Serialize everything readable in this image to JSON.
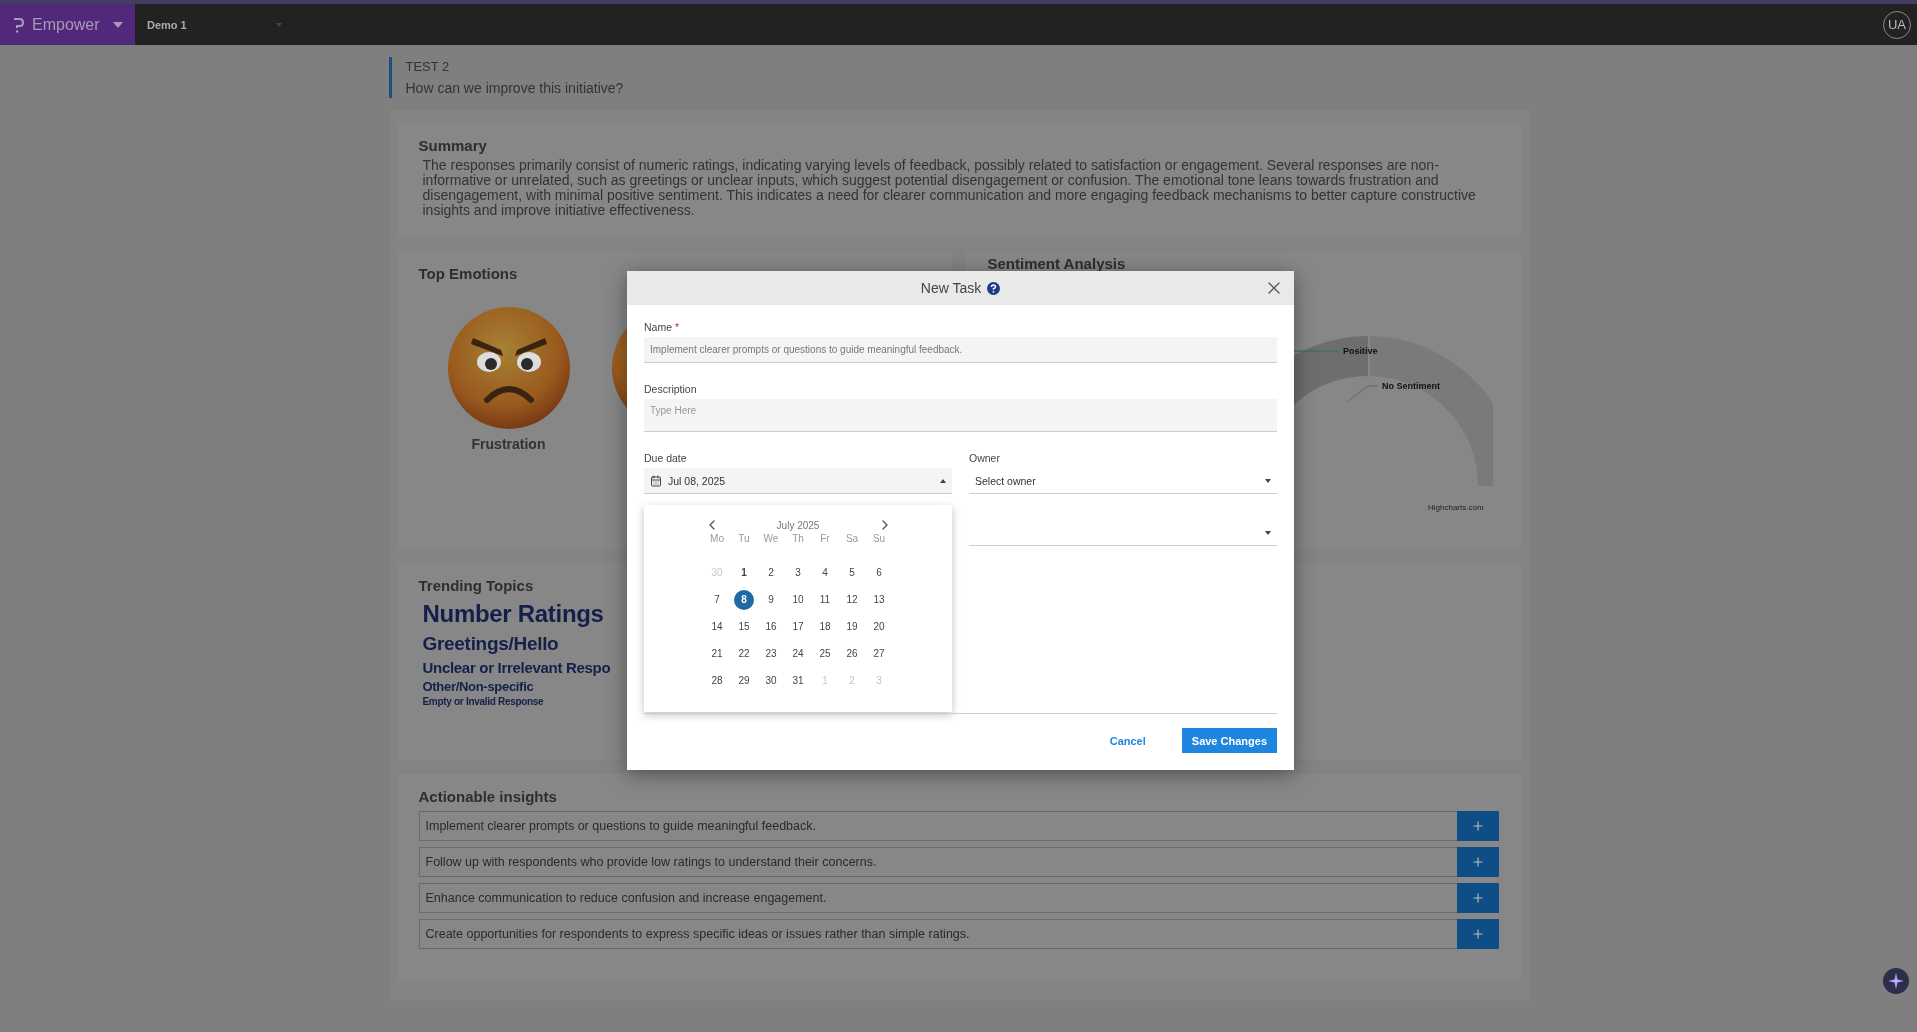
{
  "top_bar": {
    "app_name": "Empower",
    "project": "Demo 1",
    "avatar": "UA"
  },
  "header": {
    "title": "TEST 2",
    "question": "How can we improve this initiative?"
  },
  "summary": {
    "title": "Summary",
    "text": "The responses primarily consist of numeric ratings, indicating varying levels of feedback, possibly related to satisfaction or engagement. Several responses are non-informative or unrelated, such as greetings or unclear inputs, which suggest potential disengagement or confusion. The emotional tone leans towards frustration and disengagement, with minimal positive sentiment. This indicates a need for clearer communication and more engaging feedback mechanisms to better capture constructive insights and improve initiative effectiveness."
  },
  "top_emotions": {
    "title": "Top Emotions",
    "emotions": [
      {
        "label": "Frustration"
      }
    ]
  },
  "sentiment": {
    "title": "Sentiment Analysis",
    "labels": [
      "Positive",
      "No Sentiment"
    ],
    "credit": "Highcharts.com"
  },
  "trending_topics": {
    "title": "Trending Topics",
    "topics": [
      "Number Ratings",
      "Greetings/Hello",
      "Unclear or Irrelevant Respo",
      "Other/Non-specific",
      "Empty or Invalid Response"
    ]
  },
  "actionable_insights": {
    "title": "Actionable insights",
    "items": [
      "Implement clearer prompts or questions to guide meaningful feedback.",
      "Follow up with respondents who provide low ratings to understand their concerns.",
      "Enhance communication to reduce confusion and increase engagement.",
      "Create opportunities for respondents to express specific ideas or issues rather than simple ratings."
    ]
  },
  "modal": {
    "title": "New Task",
    "name_label": "Name",
    "required_mark": "*",
    "name_value": "Implement clearer prompts or questions to guide meaningful feedback.",
    "description_label": "Description",
    "description_placeholder": "Type Here",
    "due_date_label": "Due date",
    "due_date_value": "Jul 08, 2025",
    "owner_label": "Owner",
    "owner_value": "Select owner",
    "cancel": "Cancel",
    "save": "Save Changes",
    "calendar": {
      "month": "July 2025",
      "weekdays": [
        "Mo",
        "Tu",
        "We",
        "Th",
        "Fr",
        "Sa",
        "Su"
      ],
      "days": [
        {
          "label": "30",
          "outside": true,
          "selected": false,
          "highlighted": false
        },
        {
          "label": "1",
          "outside": false,
          "selected": false,
          "highlighted": true
        },
        {
          "label": "2",
          "outside": false,
          "selected": false,
          "highlighted": false
        },
        {
          "label": "3",
          "outside": false,
          "selected": false,
          "highlighted": false
        },
        {
          "label": "4",
          "outside": false,
          "selected": false,
          "highlighted": false
        },
        {
          "label": "5",
          "outside": false,
          "selected": false,
          "highlighted": false
        },
        {
          "label": "6",
          "outside": false,
          "selected": false,
          "highlighted": false
        },
        {
          "label": "7",
          "outside": false,
          "selected": false,
          "highlighted": false
        },
        {
          "label": "8",
          "outside": false,
          "selected": true,
          "highlighted": false
        },
        {
          "label": "9",
          "outside": false,
          "selected": false,
          "highlighted": false
        },
        {
          "label": "10",
          "outside": false,
          "selected": false,
          "highlighted": false
        },
        {
          "label": "11",
          "outside": false,
          "selected": false,
          "highlighted": false
        },
        {
          "label": "12",
          "outside": false,
          "selected": false,
          "highlighted": false
        },
        {
          "label": "13",
          "outside": false,
          "selected": false,
          "highlighted": false
        },
        {
          "label": "14",
          "outside": false,
          "selected": false,
          "highlighted": false
        },
        {
          "label": "15",
          "outside": false,
          "selected": false,
          "highlighted": false
        },
        {
          "label": "16",
          "outside": false,
          "selected": false,
          "highlighted": false
        },
        {
          "label": "17",
          "outside": false,
          "selected": false,
          "highlighted": false
        },
        {
          "label": "18",
          "outside": false,
          "selected": false,
          "highlighted": false
        },
        {
          "label": "19",
          "outside": false,
          "selected": false,
          "highlighted": false
        },
        {
          "label": "20",
          "outside": false,
          "selected": false,
          "highlighted": false
        },
        {
          "label": "21",
          "outside": false,
          "selected": false,
          "highlighted": false
        },
        {
          "label": "22",
          "outside": false,
          "selected": false,
          "highlighted": false
        },
        {
          "label": "23",
          "outside": false,
          "selected": false,
          "highlighted": false
        },
        {
          "label": "24",
          "outside": false,
          "selected": false,
          "highlighted": false
        },
        {
          "label": "25",
          "outside": false,
          "selected": false,
          "highlighted": false
        },
        {
          "label": "26",
          "outside": false,
          "selected": false,
          "highlighted": false
        },
        {
          "label": "27",
          "outside": false,
          "selected": false,
          "highlighted": false
        },
        {
          "label": "28",
          "outside": false,
          "selected": false,
          "highlighted": false
        },
        {
          "label": "29",
          "outside": false,
          "selected": false,
          "highlighted": false
        },
        {
          "label": "30",
          "outside": false,
          "selected": false,
          "highlighted": false
        },
        {
          "label": "31",
          "outside": false,
          "selected": false,
          "highlighted": false
        },
        {
          "label": "1",
          "outside": true,
          "selected": false,
          "highlighted": false
        },
        {
          "label": "2",
          "outside": true,
          "selected": false,
          "highlighted": false
        },
        {
          "label": "3",
          "outside": true,
          "selected": false,
          "highlighted": false
        }
      ]
    }
  }
}
